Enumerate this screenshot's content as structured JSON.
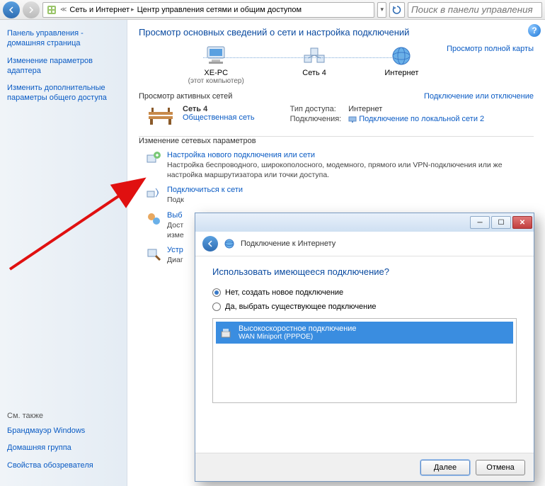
{
  "toolbar": {
    "breadcrumb_1": "Сеть и Интернет",
    "breadcrumb_2": "Центр управления сетями и общим доступом",
    "search_placeholder": "Поиск в панели управления"
  },
  "sidebar": {
    "links": [
      "Панель управления - домашняя страница",
      "Изменение параметров адаптера",
      "Изменить дополнительные параметры общего доступа"
    ],
    "also_label": "См. также",
    "also_links": [
      "Брандмауэр Windows",
      "Домашняя группа",
      "Свойства обозревателя"
    ]
  },
  "main": {
    "title": "Просмотр основных сведений о сети и настройка подключений",
    "full_map_link": "Просмотр полной карты",
    "nodes": {
      "pc": {
        "name": "XE-PC",
        "sub": "(этот компьютер)"
      },
      "net": {
        "name": "Сеть 4"
      },
      "internet": {
        "name": "Интернет"
      }
    },
    "active_label": "Просмотр активных сетей",
    "connect_link": "Подключение или отключение",
    "active": {
      "name": "Сеть 4",
      "type": "Общественная сеть",
      "access_k": "Тип доступа:",
      "access_v": "Интернет",
      "conn_k": "Подключения:",
      "conn_v": "Подключение по локальной сети 2"
    },
    "change_label": "Изменение сетевых параметров",
    "opts": [
      {
        "title": "Настройка нового подключения или сети",
        "desc": "Настройка беспроводного, широкополосного, модемного, прямого или VPN-подключения или же настройка маршрутизатора или точки доступа."
      },
      {
        "title": "Подключиться к сети",
        "desc": "Подк"
      },
      {
        "title": "Выб",
        "desc": "Дост\nизме"
      },
      {
        "title": "Устр",
        "desc": "Диаг"
      }
    ]
  },
  "dialog": {
    "title": "Подключение к Интернету",
    "question": "Использовать имеющееся подключение?",
    "radio1": "Нет, создать новое подключение",
    "radio2": "Да, выбрать существующее подключение",
    "item_name": "Высокоскоростное подключение",
    "item_sub": "WAN Miniport (PPPOE)",
    "btn_next": "Далее",
    "btn_cancel": "Отмена"
  }
}
